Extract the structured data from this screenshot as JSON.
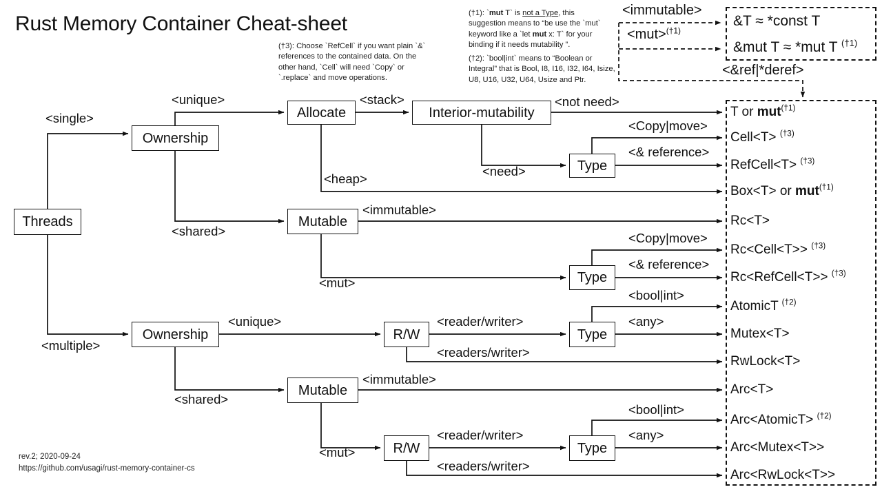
{
  "title": "Rust Memory Container Cheat-sheet",
  "notes": {
    "n3_prefix": "(†3): ",
    "n3": "Choose `RefCell` if you want plain `&` references to the contained data. On the other hand, `Cell` will need `Copy` or `.replace` and move operations.",
    "n1_prefix": "(†1): ",
    "n1_a": "`",
    "n1_mut": "mut",
    "n1_b": " T` is ",
    "n1_u": "not a Type",
    "n1_c": ", this suggestion means to “be use the `mut` keyword like a `let ",
    "n1_mut2": "mut",
    "n1_d": " x: T` for your binding if it needs mutability ”.",
    "n2_prefix": "(†2): ",
    "n2": "`bool|int` means to “Boolean or Integral” that is Bool, I8, I16, I32, I64, Isize, U8, U16, U32, U64,  Usize and Ptr."
  },
  "ref_box": {
    "label_immutable": "<immutable>",
    "label_mut": "<mut>",
    "label_mut_sup": "(†1)",
    "label_deref": "<&ref|*deref>",
    "row1": "&T ≈ *const T",
    "row2": "&mut T ≈ *mut T ",
    "row2_sup": "(†1)"
  },
  "nodes": {
    "threads": "Threads",
    "ownership_single": "Ownership",
    "ownership_multiple": "Ownership",
    "allocate": "Allocate",
    "interior_mutability": "Interior-mutability",
    "type_a": "Type",
    "type_b": "Type",
    "type_c": "Type",
    "type_d": "Type",
    "mutable_single": "Mutable",
    "mutable_multiple": "Mutable",
    "rw_unique": "R/W",
    "rw_shared": "R/W"
  },
  "edges": {
    "single": "<single>",
    "multiple": "<multiple>",
    "unique_1": "<unique>",
    "shared_1": "<shared>",
    "unique_2": "<unique>",
    "shared_2": "<shared>",
    "stack": "<stack>",
    "heap": "<heap>",
    "not_need": "<not need>",
    "need": "<need>",
    "copy_move_1": "<Copy|move>",
    "reference_1": "<& reference>",
    "immutable_1": "<immutable>",
    "mut_1": "<mut>",
    "copy_move_2": "<Copy|move>",
    "reference_2": "<& reference>",
    "reader_writer_1": "<reader/writer>",
    "readers_writer_1": "<readers/writer>",
    "bool_int_1": "<bool|int>",
    "any_1": "<any>",
    "immutable_2": "<immutable>",
    "mut_2": "<mut>",
    "reader_writer_2": "<reader/writer>",
    "readers_writer_2": "<readers/writer>",
    "bool_int_2": "<bool|int>",
    "any_2": "<any>"
  },
  "results": [
    {
      "text": "T or ",
      "bold": "mut",
      "sup": "(†1)"
    },
    {
      "text": "Cell<T> ",
      "bold": "",
      "sup": "(†3)"
    },
    {
      "text": "RefCell<T> ",
      "bold": "",
      "sup": "(†3)"
    },
    {
      "text": "Box<T> or ",
      "bold": "mut",
      "sup": "(†1)"
    },
    {
      "text": "Rc<T>",
      "bold": "",
      "sup": ""
    },
    {
      "text": "Rc<Cell<T>> ",
      "bold": "",
      "sup": "(†3)"
    },
    {
      "text": "Rc<RefCell<T>> ",
      "bold": "",
      "sup": "(†3)"
    },
    {
      "text": "AtomicT ",
      "bold": "",
      "sup": "(†2)"
    },
    {
      "text": "Mutex<T>",
      "bold": "",
      "sup": ""
    },
    {
      "text": "RwLock<T>",
      "bold": "",
      "sup": ""
    },
    {
      "text": "Arc<T>",
      "bold": "",
      "sup": ""
    },
    {
      "text": "Arc<AtomicT> ",
      "bold": "",
      "sup": "(†2)"
    },
    {
      "text": "Arc<Mutex<T>>",
      "bold": "",
      "sup": ""
    },
    {
      "text": "Arc<RwLock<T>>",
      "bold": "",
      "sup": ""
    }
  ],
  "footer": {
    "rev": "rev.2; 2020-09-24",
    "url": "https://github.com/usagi/rust-memory-container-cs"
  },
  "colors": {
    "ink": "#111111",
    "background": "#ffffff"
  }
}
